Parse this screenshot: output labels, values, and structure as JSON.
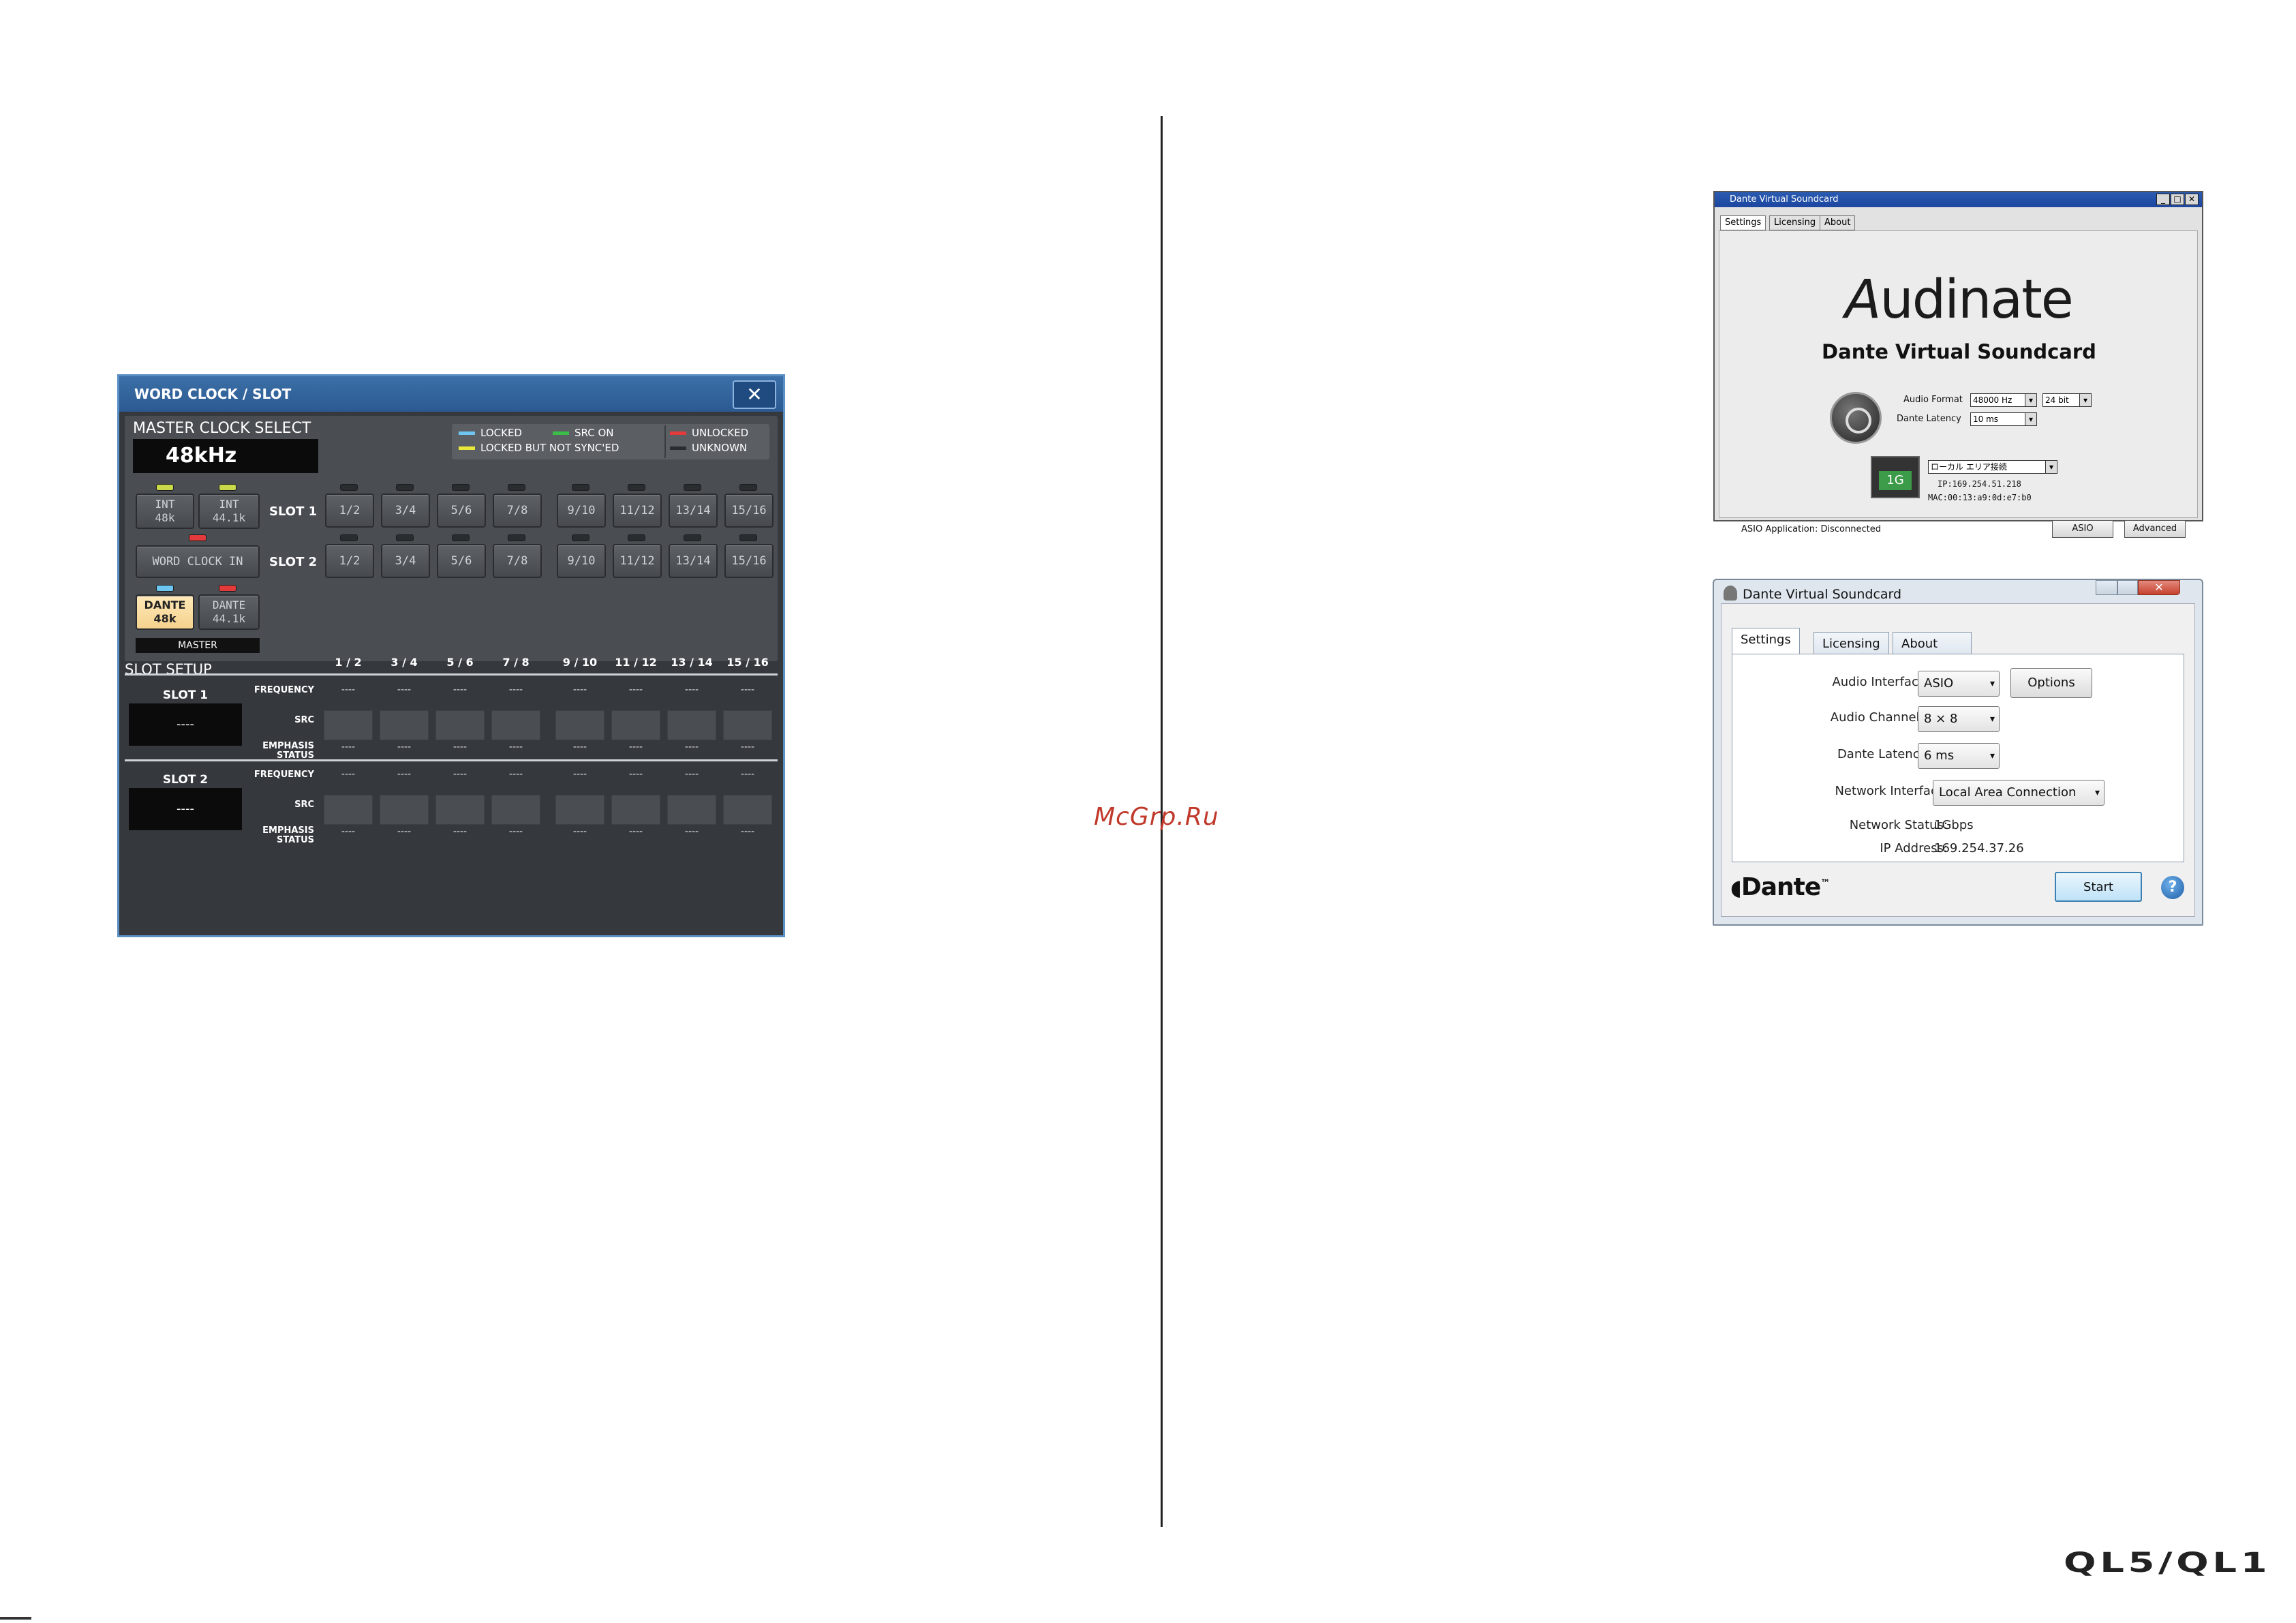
{
  "watermark": "McGrp.Ru",
  "brand": "QL5/QL1",
  "word_clock": {
    "title": "WORD CLOCK / SLOT",
    "close": "✕",
    "master_clock_label": "MASTER CLOCK SELECT",
    "master_value": "48kHz",
    "legend": {
      "locked": "LOCKED",
      "src_on": "SRC ON",
      "unlocked": "UNLOCKED",
      "locked_not_synced": "LOCKED BUT NOT SYNC'ED",
      "unknown": "UNKNOWN"
    },
    "int48": [
      "INT",
      "48k"
    ],
    "int441": [
      "INT",
      "44.1k"
    ],
    "word_clock_in": "WORD CLOCK IN",
    "dante48": [
      "DANTE",
      "48k"
    ],
    "dante441": [
      "DANTE",
      "44.1k"
    ],
    "master": "MASTER",
    "slot1": "SLOT 1",
    "slot2": "SLOT 2",
    "channels": [
      "1/2",
      "3/4",
      "5/6",
      "7/8",
      "9/10",
      "11/12",
      "13/14",
      "15/16"
    ],
    "setup_label": "SLOT SETUP",
    "setup_cols": [
      "1 / 2",
      "3 / 4",
      "5 / 6",
      "7 / 8",
      "9 / 10",
      "11 / 12",
      "13 / 14",
      "15 / 16"
    ],
    "frequency": "FREQUENCY",
    "src": "SRC",
    "emphasis": [
      "EMPHASIS",
      "STATUS"
    ],
    "dashes": "----",
    "colors": {
      "locked": "#6ec6f0",
      "src_on": "#3bbd4a",
      "unlocked": "#e33b3b",
      "not_synced": "#e8e83a",
      "unknown": "#2a2d30"
    }
  },
  "dvs1": {
    "title": "Dante Virtual Soundcard",
    "tabs": [
      "Settings",
      "Licensing",
      "About"
    ],
    "logo_prefix": "udinate",
    "logo_i": "i",
    "subtitle": "Dante Virtual Soundcard",
    "audio_format_label": "Audio Format",
    "audio_format": "48000 Hz",
    "bit_depth": "24 bit",
    "latency_label": "Dante Latency",
    "latency": "10 ms",
    "network": "ローカル エリア接続",
    "link_speed": "1G",
    "ip": "IP:169.254.51.218",
    "mac": "MAC:00:13:a9:0d:e7:b0",
    "asio_status": "ASIO Application: Disconnected",
    "asio_btn": "ASIO",
    "advanced_btn": "Advanced",
    "win_buttons": [
      "_",
      "□",
      "✕"
    ]
  },
  "dvs2": {
    "title": "Dante Virtual Soundcard",
    "tabs": [
      "Settings",
      "Licensing",
      "About"
    ],
    "audio_interface_label": "Audio Interface:",
    "audio_interface": "ASIO",
    "options_btn": "Options",
    "audio_channels_label": "Audio Channels:",
    "audio_channels": "8 × 8",
    "latency_label": "Dante Latency:",
    "latency": "6 ms",
    "network_interface_label": "Network Interface:",
    "network_interface": "Local Area Connection",
    "network_status_label": "Network Status:",
    "network_status": "1Gbps",
    "ip_label": "IP Address:",
    "ip": "169.254.37.26",
    "start_btn": "Start",
    "logo": "Dante",
    "logo_tm": "™",
    "help": "?",
    "close": "✕"
  }
}
